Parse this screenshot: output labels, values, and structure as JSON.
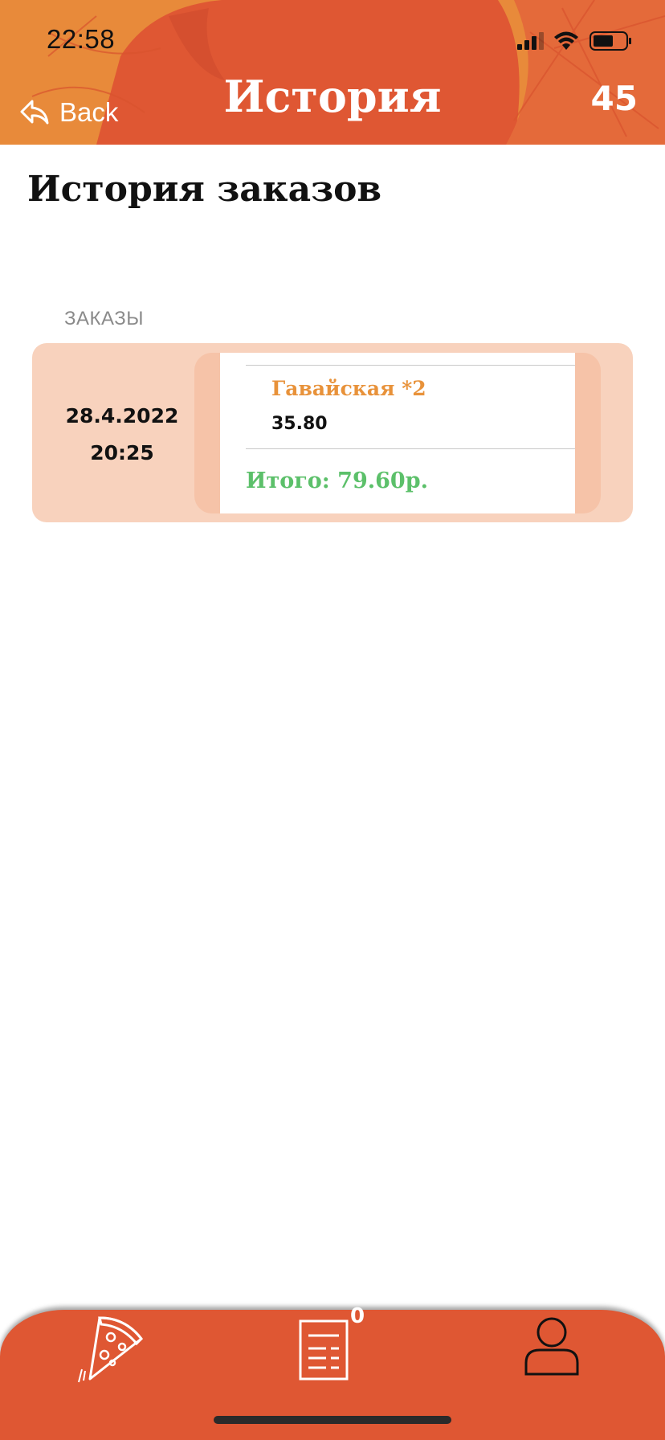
{
  "status_bar": {
    "time": "22:58"
  },
  "header": {
    "back_label": "Back",
    "title": "История",
    "counter": "45",
    "color_primary": "#df5733",
    "color_secondary": "#e88a3a"
  },
  "main": {
    "page_title": "История заказов",
    "section_label": "ЗАКАЗЫ",
    "orders": [
      {
        "date": "28.4.2022",
        "time": "20:25",
        "items": [
          {
            "name": "Гавайская *2",
            "price": "35.80"
          }
        ],
        "total": "Итого: 79.60р."
      }
    ]
  },
  "tabbar": {
    "tabs": [
      {
        "icon": "pizza-icon"
      },
      {
        "icon": "receipt-icon",
        "badge": "0"
      },
      {
        "icon": "profile-icon"
      }
    ]
  }
}
